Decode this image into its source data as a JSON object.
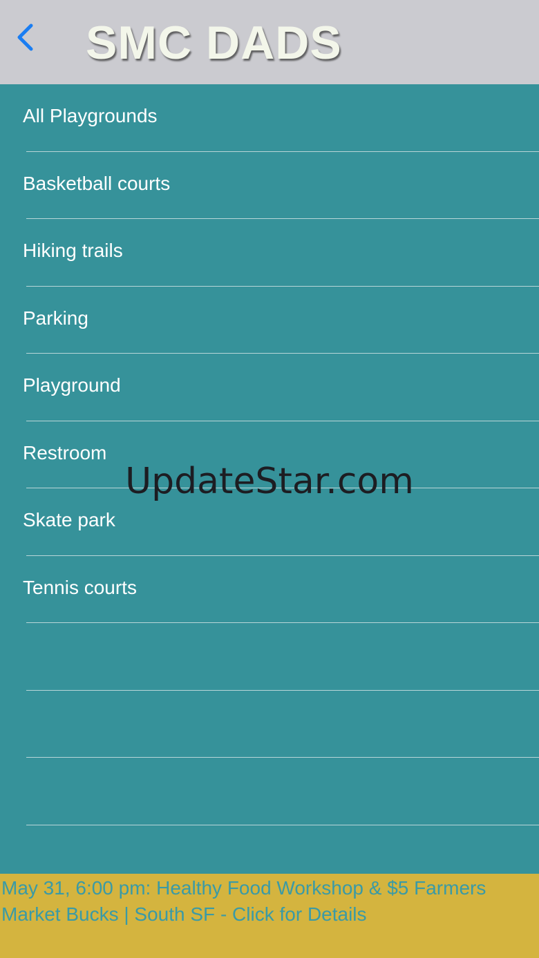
{
  "navbar": {
    "title": "SMC DADS",
    "back_icon": "chevron-left-icon",
    "back_color": "#1a7df2",
    "background": "#cbcbd0"
  },
  "list": {
    "background": "#36929a",
    "items": [
      {
        "label": "All Playgrounds"
      },
      {
        "label": "Basketball courts"
      },
      {
        "label": "Hiking trails"
      },
      {
        "label": "Parking"
      },
      {
        "label": "Playground"
      },
      {
        "label": "Restroom"
      },
      {
        "label": "Skate park"
      },
      {
        "label": "Tennis courts"
      },
      {
        "label": ""
      },
      {
        "label": ""
      },
      {
        "label": ""
      }
    ]
  },
  "watermark": {
    "text": "UpdateStar.com"
  },
  "banner": {
    "text": "May 31, 6:00 pm: Healthy Food Workshop & $5 Farmers Market Bucks | South SF - Click for Details",
    "background": "#d4b43f",
    "text_color": "#3a9aa6"
  }
}
